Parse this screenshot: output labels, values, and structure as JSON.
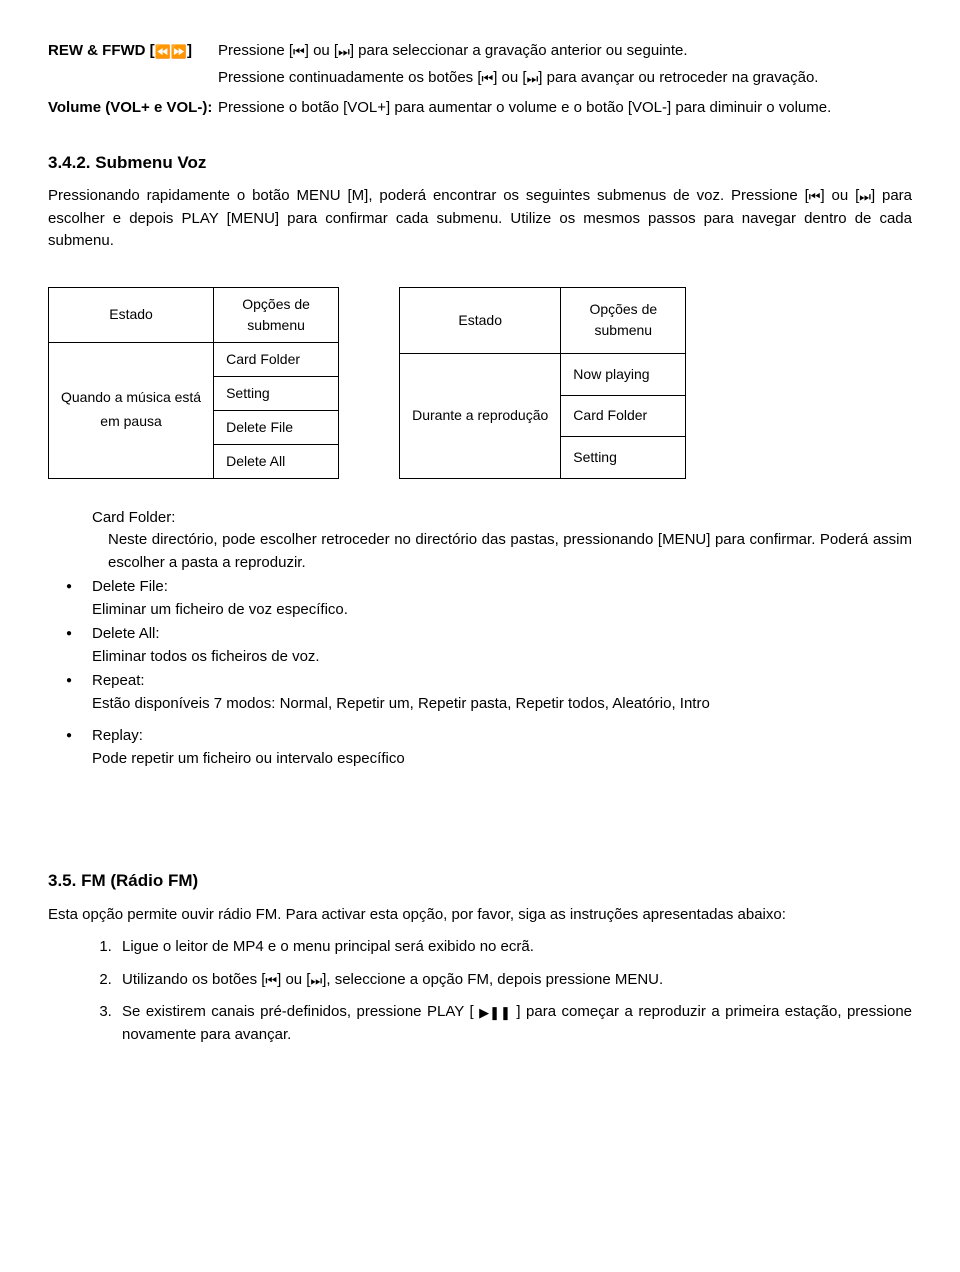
{
  "defs": {
    "rew": {
      "label_pre": "REW & FFWD [",
      "label_post": "]",
      "p1_a": "Pressione [",
      "p1_b": "] ou [",
      "p1_c": "] para seleccionar a gravação anterior ou seguinte.",
      "p2_a": "Pressione continuadamente os botões [",
      "p2_b": "] ou [",
      "p2_c": "] para avançar ou retroceder na gravação."
    },
    "vol": {
      "label": "Volume (VOL+ e VOL-):",
      "p1": "Pressione o botão [VOL+] para aumentar o volume e o botão [VOL-] para diminuir o volume."
    }
  },
  "sec342": {
    "title": "3.4.2. Submenu Voz",
    "p1_a": "Pressionando rapidamente o botão MENU [M], poderá encontrar os seguintes submenus de voz. Pressione [",
    "p1_b": "] ou [",
    "p1_c": "] para escolher e depois PLAY [MENU] para confirmar cada submenu. Utilize os mesmos passos para navegar dentro de cada submenu."
  },
  "tables": {
    "left": {
      "h_state": "Estado",
      "h_opt1": "Opções de",
      "h_opt2": "submenu",
      "state1": "Quando a música está",
      "state2": "em pausa",
      "r1": "Card Folder",
      "r2": "Setting",
      "r3": "Delete File",
      "r4": "Delete All"
    },
    "right": {
      "h_state": "Estado",
      "h_opt1": "Opções de",
      "h_opt2": "submenu",
      "state": "Durante a reprodução",
      "r1": "Now playing",
      "r2": "Card Folder",
      "r3": "Setting"
    }
  },
  "list": {
    "card_head": "Card Folder:",
    "card_body": "Neste directório, pode escolher retroceder no directório das pastas, pressionando [MENU] para confirmar. Poderá assim escolher a pasta a reproduzir.",
    "delfile_head": "Delete File:",
    "delfile_body": "Eliminar um ficheiro de voz específico.",
    "delall_head": "Delete All:",
    "delall_body": "Eliminar todos os ficheiros de voz.",
    "repeat_head": "Repeat:",
    "repeat_body": "Estão disponíveis 7 modos: Normal, Repetir um, Repetir pasta, Repetir todos, Aleatório, Intro",
    "replay_head": "Replay:",
    "replay_body": "Pode repetir um ficheiro ou intervalo específico"
  },
  "sec35": {
    "title": "3.5.  FM (Rádio FM)",
    "intro": "Esta opção permite ouvir rádio FM. Para activar esta opção, por favor, siga as instruções apresentadas abaixo:",
    "n1": "Ligue o leitor de MP4 e o menu principal será exibido no ecrã.",
    "n2_a": "Utilizando os botões [",
    "n2_b": "] ou [",
    "n2_c": "], seleccione a opção FM, depois pressione MENU.",
    "n3_a": "Se existirem canais pré-definidos, pressione PLAY [",
    "n3_b": "] para começar a reproduzir a primeira estação, pressione novamente para avançar."
  },
  "icons": {
    "rew_pair": "⏪⏩",
    "prev": "⏮",
    "next": "⏭",
    "playpause": "▶❚❚"
  }
}
